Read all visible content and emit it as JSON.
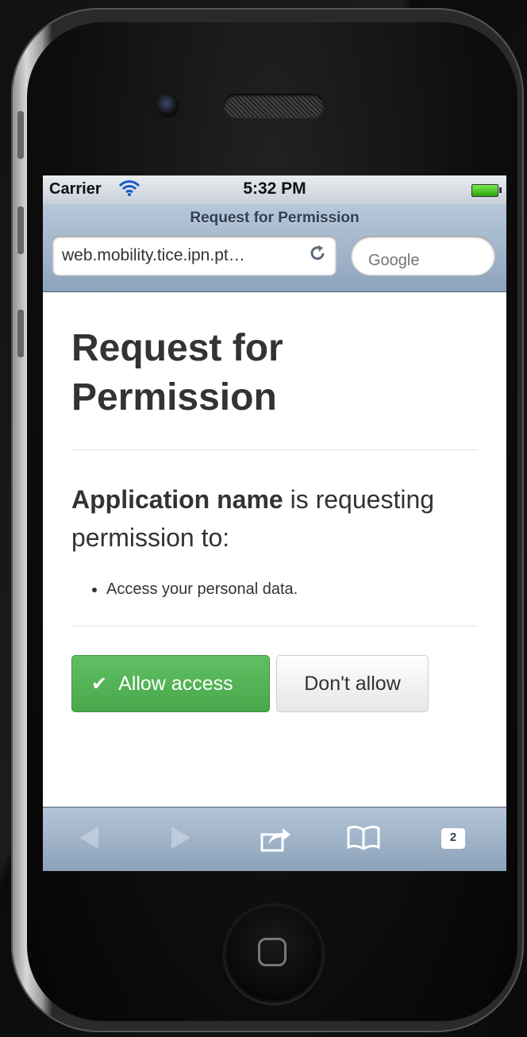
{
  "statusbar": {
    "carrier": "Carrier",
    "time": "5:32 PM"
  },
  "browser": {
    "page_title": "Request for Permission",
    "url": "web.mobility.tice.ipn.pt…",
    "search_placeholder": "Google"
  },
  "page": {
    "heading": "Request for Permission",
    "app_name": "Application name",
    "request_text": " is requesting permission to:",
    "permissions": [
      "Access your personal data."
    ],
    "allow_label": "Allow access",
    "deny_label": "Don't allow"
  },
  "toolbar": {
    "tab_count": "2"
  },
  "colors": {
    "allow_green": "#5cb85c",
    "nav_blue": "#9bb0c8"
  }
}
